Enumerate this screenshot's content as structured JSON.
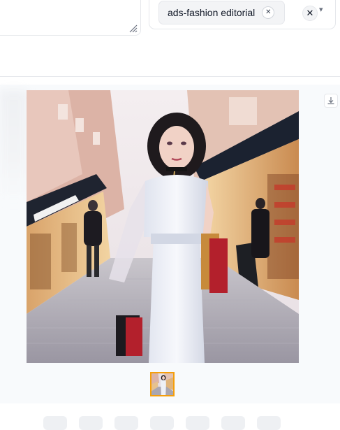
{
  "style_selector": {
    "selected_chip_label": "ads-fashion editorial",
    "chip_remove_icon": "close-icon",
    "clear_icon": "close-icon",
    "dropdown_icon": "chevron-down-icon"
  },
  "prompt_box": {
    "resize_icon": "resize-grip-icon"
  },
  "gallery": {
    "download_icon": "download-icon",
    "thumbnail_selected": true,
    "thumbnail_count": 1
  },
  "colors": {
    "accent": "#f59e0b",
    "panel_border": "#e5e7eb",
    "chip_bg": "#f3f4f6",
    "gallery_bg": "#f8fafc"
  }
}
